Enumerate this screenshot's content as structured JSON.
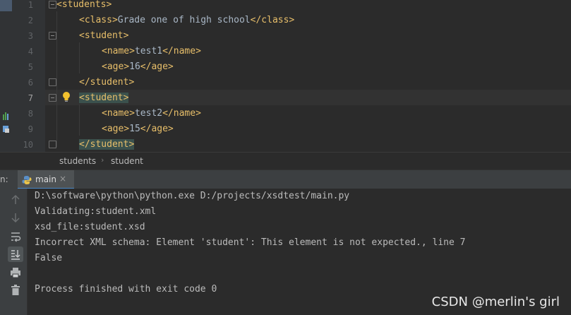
{
  "editor": {
    "line_numbers": [
      "1",
      "2",
      "3",
      "4",
      "5",
      "6",
      "7",
      "8",
      "9",
      "10"
    ],
    "lines": [
      {
        "parts": [
          {
            "t": "<students>",
            "c": "tag"
          }
        ]
      },
      {
        "parts": [
          {
            "t": "<class>",
            "c": "tag"
          },
          {
            "t": "Grade one of high school",
            "c": "txt"
          },
          {
            "t": "</class>",
            "c": "tag"
          }
        ]
      },
      {
        "parts": [
          {
            "t": "<student>",
            "c": "tag"
          }
        ]
      },
      {
        "parts": [
          {
            "t": "<name>",
            "c": "tag"
          },
          {
            "t": "test1",
            "c": "txt"
          },
          {
            "t": "</name>",
            "c": "tag"
          }
        ]
      },
      {
        "parts": [
          {
            "t": "<age>",
            "c": "tag"
          },
          {
            "t": "16",
            "c": "txt"
          },
          {
            "t": "</age>",
            "c": "tag"
          }
        ]
      },
      {
        "parts": [
          {
            "t": "</student>",
            "c": "tag"
          }
        ]
      },
      {
        "parts": [
          {
            "t": "<student>",
            "c": "tag hl"
          }
        ]
      },
      {
        "parts": [
          {
            "t": "<name>",
            "c": "tag"
          },
          {
            "t": "test2",
            "c": "txt"
          },
          {
            "t": "</name>",
            "c": "tag"
          }
        ]
      },
      {
        "parts": [
          {
            "t": "<age>",
            "c": "tag"
          },
          {
            "t": "15",
            "c": "txt"
          },
          {
            "t": "</age>",
            "c": "tag"
          }
        ]
      },
      {
        "parts": [
          {
            "t": "</student>",
            "c": "tag hl"
          }
        ]
      }
    ],
    "current_line": "7",
    "intention_icon": "lightbulb-icon"
  },
  "breadcrumb": {
    "items": [
      "students",
      "student"
    ],
    "separator": "›"
  },
  "run_panel": {
    "label": "n:",
    "tab_label": "main",
    "tab_icon": "python-icon",
    "close_glyph": "×"
  },
  "console": {
    "lines": [
      "D:\\software\\python\\python.exe D:/projects/xsdtest/main.py",
      "Validating:student.xml",
      "xsd_file:student.xsd",
      "Incorrect XML schema: Element 'student': This element is not expected., line 7",
      "False",
      "",
      "Process finished with exit code 0"
    ]
  },
  "toolbar_icons": [
    "arrow-up-icon",
    "arrow-down-icon",
    "soft-wrap-icon",
    "scroll-to-end-icon",
    "print-icon",
    "trash-icon"
  ],
  "watermark": "CSDN @merlin's girl",
  "colors": {
    "background": "#2b2b2b",
    "gutter": "#313335",
    "tag": "#e8bf6a",
    "text": "#a9b7c6",
    "console_text": "#bbbbbb",
    "tag_highlight": "#3b514d",
    "tab_underline": "#4a88c7"
  }
}
